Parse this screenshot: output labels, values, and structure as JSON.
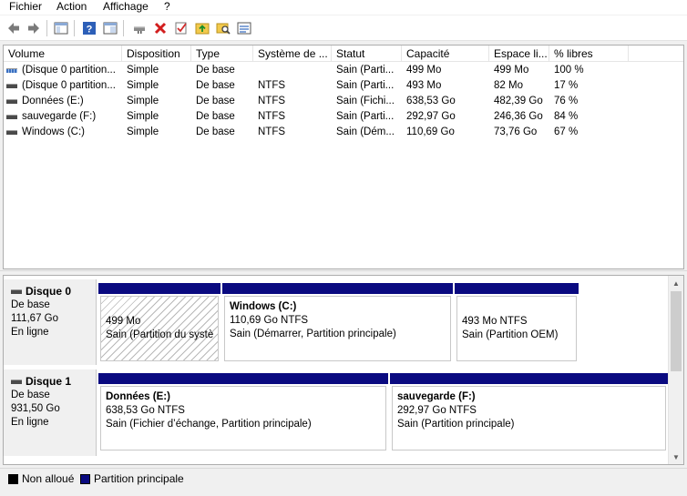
{
  "menu": [
    "Fichier",
    "Action",
    "Affichage",
    "?"
  ],
  "toolbar": {
    "icons": [
      "back-icon",
      "forward-icon",
      "console-tree-icon",
      "help-icon",
      "properties-icon",
      "connect-drive-icon",
      "delete-icon",
      "check-icon",
      "folder-up-icon",
      "search-folder-icon",
      "details-icon"
    ]
  },
  "volume_list": {
    "columns": [
      "Volume",
      "Disposition",
      "Type",
      "Système de ...",
      "Statut",
      "Capacité",
      "Espace li...",
      "% libres"
    ],
    "rows": [
      [
        "(Disque 0 partition...",
        "Simple",
        "De base",
        "",
        "Sain (Parti...",
        "499 Mo",
        "499 Mo",
        "100 %"
      ],
      [
        "(Disque 0 partition...",
        "Simple",
        "De base",
        "NTFS",
        "Sain (Parti...",
        "493 Mo",
        "82 Mo",
        "17 %"
      ],
      [
        "Données (E:)",
        "Simple",
        "De base",
        "NTFS",
        "Sain (Fichi...",
        "638,53 Go",
        "482,39 Go",
        "76 %"
      ],
      [
        "sauvegarde (F:)",
        "Simple",
        "De base",
        "NTFS",
        "Sain (Parti...",
        "292,97 Go",
        "246,36 Go",
        "84 %"
      ],
      [
        "Windows (C:)",
        "Simple",
        "De base",
        "NTFS",
        "Sain (Dém...",
        "110,69 Go",
        "73,76 Go",
        "67 %"
      ]
    ]
  },
  "disks": [
    {
      "name": "Disque 0",
      "type": "De base",
      "size": "111,67 Go",
      "status": "En ligne",
      "partitions": [
        {
          "name": "",
          "size": "499 Mo",
          "status": "Sain (Partition du systè"
        },
        {
          "name": "Windows  (C:)",
          "size": "110,69 Go NTFS",
          "status": "Sain (Démarrer, Partition principale)"
        },
        {
          "name": "",
          "size": "493 Mo NTFS",
          "status": "Sain (Partition OEM)"
        }
      ]
    },
    {
      "name": "Disque 1",
      "type": "De base",
      "size": "931,50 Go",
      "status": "En ligne",
      "partitions": [
        {
          "name": "Données  (E:)",
          "size": "638,53 Go NTFS",
          "status": "Sain (Fichier d’échange, Partition principale)"
        },
        {
          "name": "sauvegarde  (F:)",
          "size": "292,97 Go NTFS",
          "status": "Sain (Partition principale)"
        }
      ]
    }
  ],
  "legend": {
    "unallocated": "Non alloué",
    "primary": "Partition principale"
  },
  "colors": {
    "primary_partition": "#0a0a80",
    "unallocated": "#000000"
  }
}
